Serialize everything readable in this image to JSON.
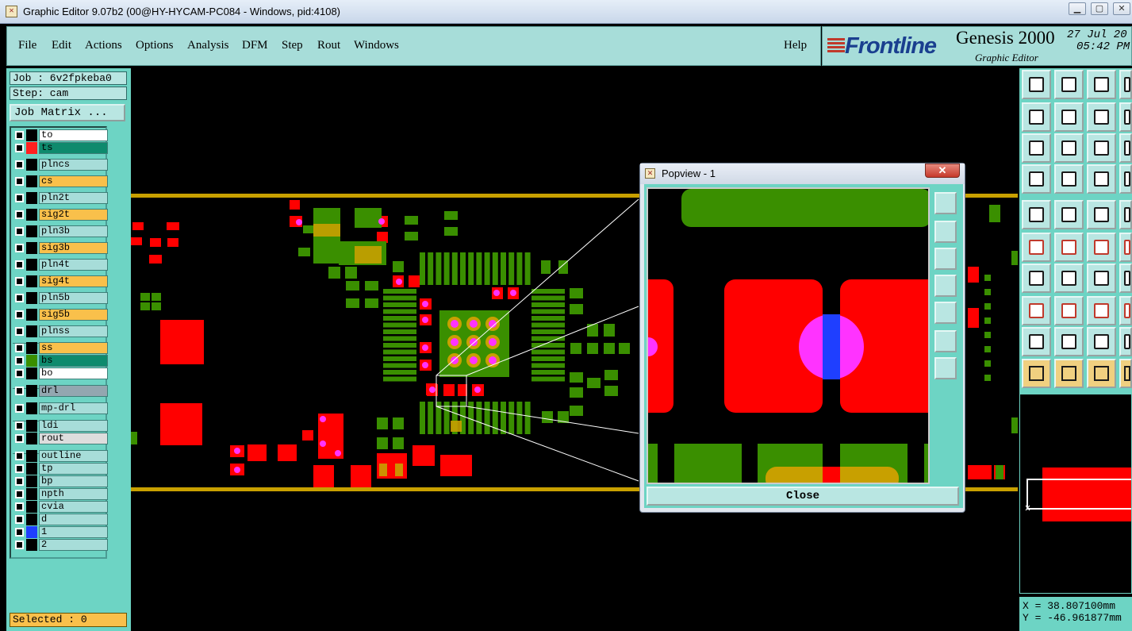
{
  "window": {
    "title": "Graphic Editor 9.07b2 (00@HY-HYCAM-PC084 - Windows, pid:4108)",
    "app_icon": "x-logo-icon"
  },
  "menu": [
    "File",
    "Edit",
    "Actions",
    "Options",
    "Analysis",
    "DFM",
    "Step",
    "Rout",
    "Windows"
  ],
  "help_label": "Help",
  "brand": {
    "logo": "Frontline",
    "product": "Genesis 2000",
    "subtitle": "Graphic Editor",
    "date": "27 Jul 20",
    "time": "05:42 PM"
  },
  "job": {
    "label": "Job : 6v2fpkeba0",
    "step": "Step: cam",
    "matrix_button": "Job Matrix ..."
  },
  "layers": [
    {
      "name": "to",
      "color": "#ffffff",
      "swatch": "#000000"
    },
    {
      "name": "ts",
      "color": "#0e8a6d",
      "swatch": "#ff2020"
    },
    {
      "name": "plncs",
      "color": "#a7ddd9",
      "swatch": "#000000"
    },
    {
      "name": "cs",
      "color": "#f9c04b",
      "swatch": "#000000"
    },
    {
      "name": "pln2t",
      "color": "#a7ddd9",
      "swatch": "#000000"
    },
    {
      "name": "sig2t",
      "color": "#f9c04b",
      "swatch": "#000000"
    },
    {
      "name": "pln3b",
      "color": "#a7ddd9",
      "swatch": "#000000"
    },
    {
      "name": "sig3b",
      "color": "#f9c04b",
      "swatch": "#000000"
    },
    {
      "name": "pln4t",
      "color": "#a7ddd9",
      "swatch": "#000000"
    },
    {
      "name": "sig4t",
      "color": "#f9c04b",
      "swatch": "#000000"
    },
    {
      "name": "pln5b",
      "color": "#a7ddd9",
      "swatch": "#000000"
    },
    {
      "name": "sig5b",
      "color": "#f9c04b",
      "swatch": "#000000"
    },
    {
      "name": "plnss",
      "color": "#a7ddd9",
      "swatch": "#000000"
    },
    {
      "name": "ss",
      "color": "#f9c04b",
      "swatch": "#000000"
    },
    {
      "name": "bs",
      "color": "#0e8a6d",
      "swatch": "#3a8f00"
    },
    {
      "name": "bo",
      "color": "#ffffff",
      "swatch": "#000000"
    },
    {
      "name": "drl",
      "color": "#93a7b0",
      "swatch": "#000000"
    },
    {
      "name": "mp-drl",
      "color": "#a7ddd9",
      "swatch": "#000000"
    },
    {
      "name": "ldi",
      "color": "#a7ddd9",
      "swatch": "#000000"
    },
    {
      "name": "rout",
      "color": "#dddddd",
      "swatch": "#000000"
    },
    {
      "name": "outline",
      "color": "#a7ddd9",
      "swatch": "#000000"
    },
    {
      "name": "tp",
      "color": "#a7ddd9",
      "swatch": "#000000"
    },
    {
      "name": "bp",
      "color": "#a7ddd9",
      "swatch": "#000000"
    },
    {
      "name": "npth",
      "color": "#a7ddd9",
      "swatch": "#000000"
    },
    {
      "name": "cvia",
      "color": "#a7ddd9",
      "swatch": "#000000"
    },
    {
      "name": "d",
      "color": "#a7ddd9",
      "swatch": "#000000"
    },
    {
      "name": "1",
      "color": "#a7ddd9",
      "swatch": "#1f3fff"
    },
    {
      "name": "2",
      "color": "#a7ddd9",
      "swatch": "#000000"
    }
  ],
  "selected": "Selected : 0",
  "popview": {
    "title": "Popview - 1",
    "close_button": "Close",
    "close_x": "✕"
  },
  "coords": {
    "x": "X = 38.807100mm",
    "y": "Y = -46.961877mm"
  },
  "toolbar_icons": [
    "zoom-in-icon",
    "zoom-out-icon",
    "home-icon",
    "pan-icon",
    "pan-left-icon",
    "pan-right-icon",
    "undo-view-icon",
    "help-icon",
    "fit-icon",
    "center-icon",
    "scale-icon",
    "query-icon",
    "snap-icon",
    "grid-icon",
    "net-icon",
    "net2-icon",
    "pad-icon",
    "measure-icon",
    "ruler-icon",
    "circle-icon",
    "connect-icon",
    "cross-icon",
    "pin-icon",
    "line-icon",
    "angle-icon",
    "arrow-icon",
    "arc-icon",
    "bracket-icon",
    "node-icon",
    "minus-icon",
    "box-icon",
    "lamp-icon",
    "triangle-icon",
    "arrow-triangle-icon",
    "triangle2-icon",
    "triangle3-icon",
    "pointer-icon",
    "select-icon",
    "select2-icon",
    "select3-icon"
  ],
  "colors": {
    "panel": "#6dd4c4",
    "copper": "#ff0000",
    "green": "#3a8f00",
    "gold": "#c8a000",
    "pad": "#ff33ff",
    "via": "#1f3fff"
  }
}
